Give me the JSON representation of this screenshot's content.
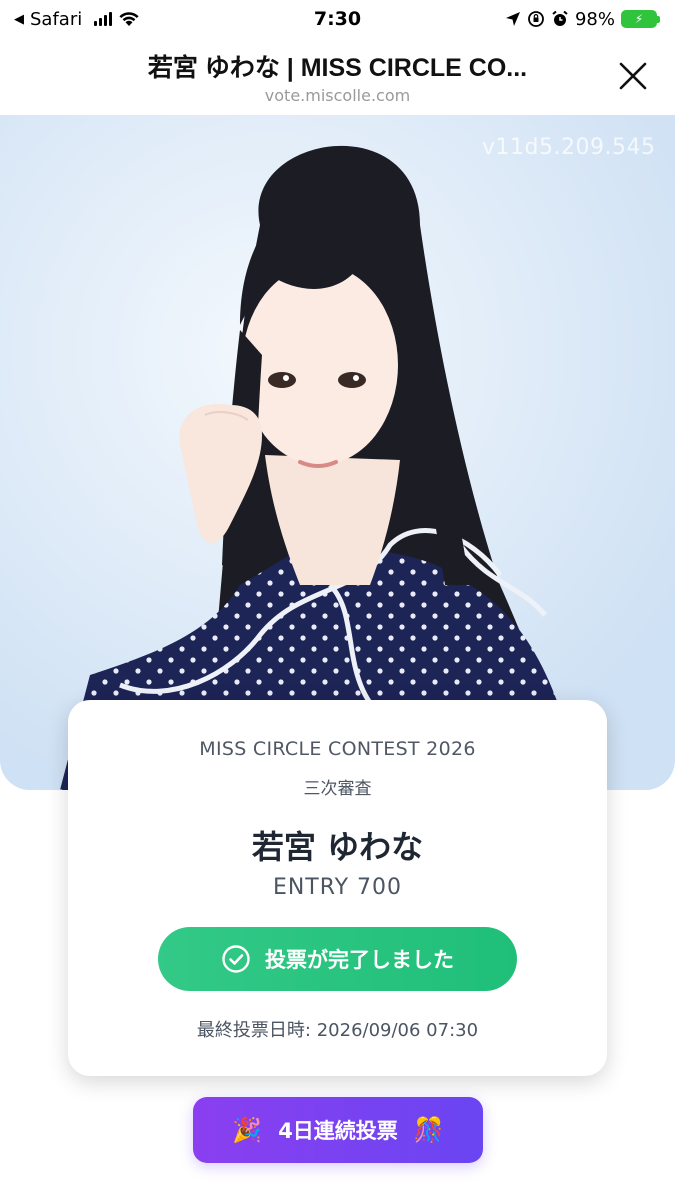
{
  "status_bar": {
    "back_app": "Safari",
    "time": "7:30",
    "battery": "98%"
  },
  "header": {
    "title": "若宮 ゆわな | MISS CIRCLE CO...",
    "url": "vote.miscolle.com"
  },
  "hero": {
    "watermark": "v11d5.209.545"
  },
  "card": {
    "contest": "MISS CIRCLE CONTEST 2026",
    "stage": "三次審査",
    "name": "若宮 ゆわな",
    "entry": "ENTRY 700",
    "vote_done_label": "投票が完了しました",
    "last_vote": "最終投票日時: 2026/09/06 07:30"
  },
  "streak": {
    "label": "4日連続投票",
    "left_emoji": "🎉",
    "right_emoji": "🎊"
  },
  "colors": {
    "green": "#2ec482",
    "purple": "#7b40f1",
    "battery": "#30c43c"
  }
}
